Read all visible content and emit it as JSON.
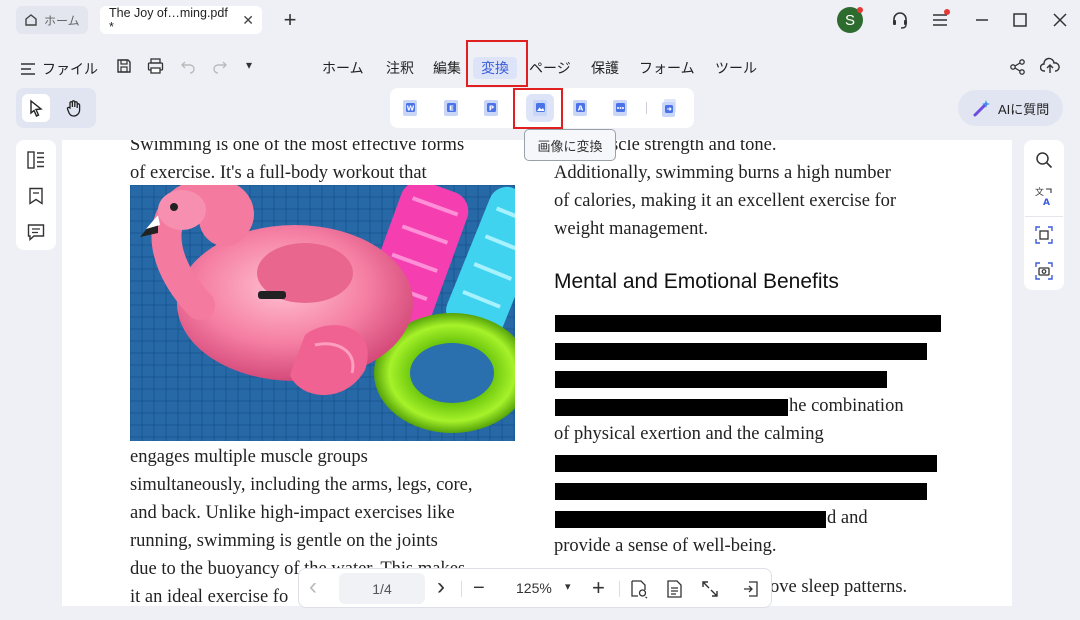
{
  "tabs": {
    "home_label": "ホーム",
    "doc_label": "The Joy of…ming.pdf *",
    "close_glyph": "✕",
    "new_tab_glyph": "+"
  },
  "account": {
    "avatar_letter": "S"
  },
  "menu": {
    "file_label": "ファイル",
    "items": [
      "ホーム",
      "注釈",
      "編集",
      "変換",
      "ページ",
      "保護",
      "フォーム",
      "ツール"
    ],
    "active_index": 3,
    "dropdown_glyph": "▾"
  },
  "convert_tools": {
    "icons": [
      "to-word-icon",
      "to-excel-icon",
      "to-powerpoint-icon",
      "to-image-icon",
      "to-text-icon",
      "to-other-icon",
      "batch-convert-icon"
    ],
    "letters": [
      "W",
      "E",
      "P",
      "",
      "A",
      "…",
      ""
    ],
    "tooltip": "画像に変換"
  },
  "ai": {
    "label": "AIに質問"
  },
  "document": {
    "left_top": [
      "Swimming is one of the most effective forms",
      "of exercise. It's a full-body workout that"
    ],
    "left_bottom": [
      "engages multiple muscle groups",
      "simultaneously, including the arms, legs, core,",
      "and back. Unlike high-impact exercises like",
      "running, swimming is gentle on the joints",
      "due to the buoyancy of the water. This makes",
      "it an ideal exercise fo"
    ],
    "right_top": [
      "ling muscle strength and tone.",
      "Additionally, swimming burns a high number",
      "of calories, making it an excellent exercise for",
      "weight management."
    ],
    "heading": "Mental and Emotional Benefits",
    "right_frag_1": "he combination",
    "right_line_2": "of physical exertion and the calming",
    "right_frag_2": "d and",
    "right_line_3": "provide a sense of well-being.",
    "right_frag_3": "ove sleep patterns."
  },
  "pager": {
    "page_indicator": "1/4",
    "zoom": "125%",
    "prev_glyph": "‹",
    "next_glyph": "›",
    "minus_glyph": "−",
    "plus_glyph": "+",
    "dropdown_glyph": "▾"
  },
  "colors": {
    "accent": "#3b5bdb",
    "highlight_box": "#e02020",
    "avatar": "#2e6b2f"
  }
}
